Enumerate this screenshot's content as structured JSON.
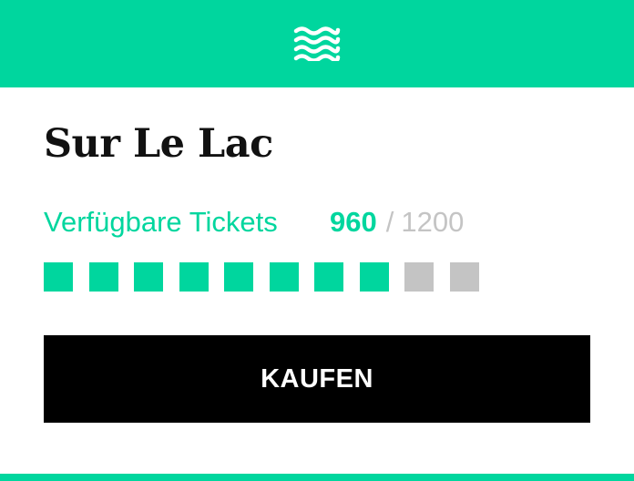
{
  "colors": {
    "accent": "#00d69e",
    "inactive": "#c4c4c4",
    "button_bg": "#000000",
    "button_text": "#ffffff"
  },
  "header": {
    "icon": "waves-icon"
  },
  "event": {
    "title": "Sur Le Lac"
  },
  "tickets": {
    "label": "Verfügbare Tickets",
    "available": "960",
    "separator": "/",
    "total": "1200",
    "squares_total": 10,
    "squares_filled": 8
  },
  "actions": {
    "buy_label": "KAUFEN"
  }
}
